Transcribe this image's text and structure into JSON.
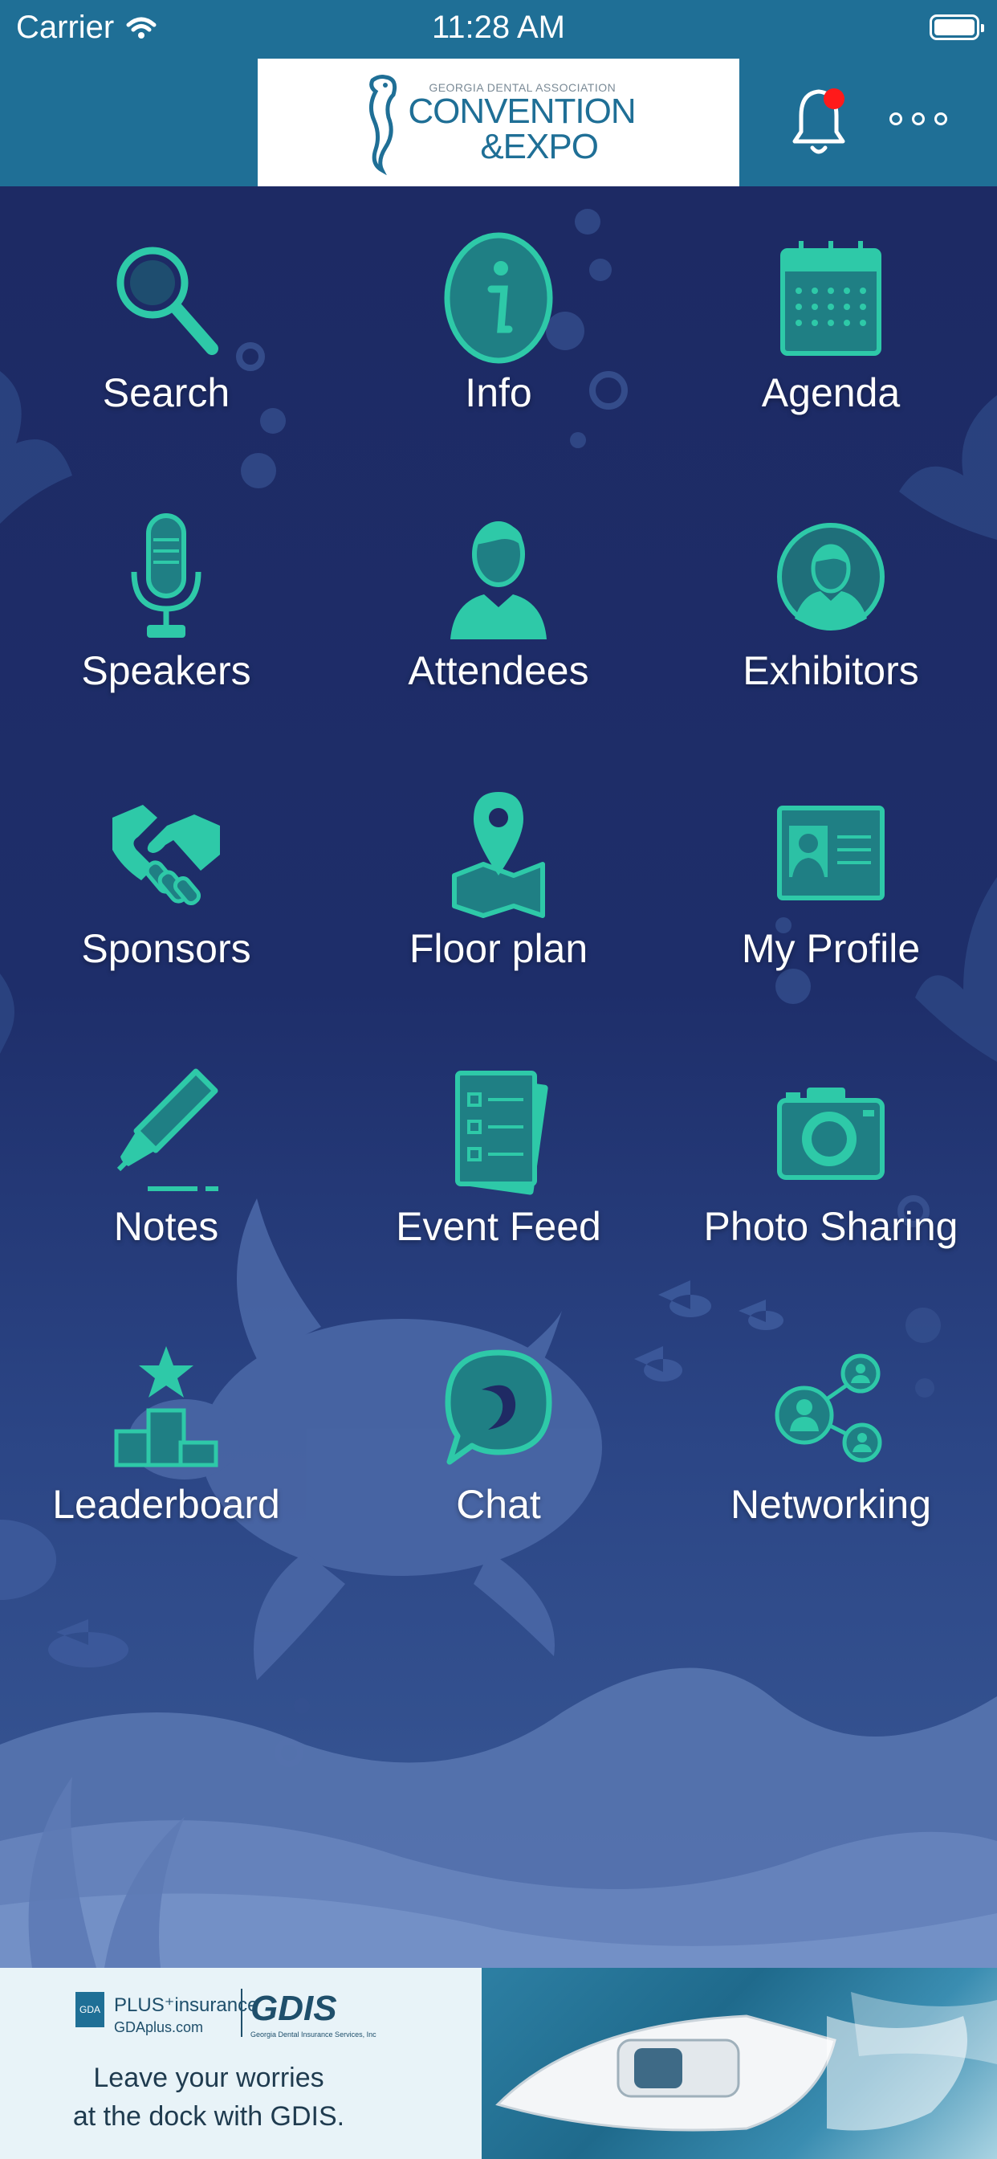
{
  "status_bar": {
    "carrier": "Carrier",
    "time": "11:28 AM"
  },
  "header": {
    "logo": {
      "small_text": "GEORGIA DENTAL ASSOCIATION",
      "line1": "CONVENTION",
      "line2": "&EXPO"
    },
    "notification_badge": true
  },
  "menu": [
    {
      "label": "Search",
      "icon": "search-icon"
    },
    {
      "label": "Info",
      "icon": "info-icon"
    },
    {
      "label": "Agenda",
      "icon": "calendar-icon"
    },
    {
      "label": "Speakers",
      "icon": "microphone-icon"
    },
    {
      "label": "Attendees",
      "icon": "person-icon"
    },
    {
      "label": "Exhibitors",
      "icon": "person-circle-icon"
    },
    {
      "label": "Sponsors",
      "icon": "handshake-icon"
    },
    {
      "label": "Floor plan",
      "icon": "map-pin-icon"
    },
    {
      "label": "My Profile",
      "icon": "id-card-icon"
    },
    {
      "label": "Notes",
      "icon": "pen-icon"
    },
    {
      "label": "Event Feed",
      "icon": "checklist-icon"
    },
    {
      "label": "Photo Sharing",
      "icon": "camera-icon"
    },
    {
      "label": "Leaderboard",
      "icon": "podium-star-icon"
    },
    {
      "label": "Chat",
      "icon": "chat-bubble-icon"
    },
    {
      "label": "Networking",
      "icon": "network-people-icon"
    }
  ],
  "ad": {
    "badge": "GDA",
    "plus_text": "PLUS⁺insurance",
    "url": "GDAplus.com",
    "brand": "GDIS",
    "brand_sub": "Georgia Dental Insurance Services, Inc",
    "tagline_1": "Leave your worries",
    "tagline_2": "at the dock with GDIS."
  },
  "colors": {
    "header": "#1f6f96",
    "icon_teal": "#2ec9a8",
    "background": "#1d2a64",
    "badge_red": "#ff1a1a"
  }
}
